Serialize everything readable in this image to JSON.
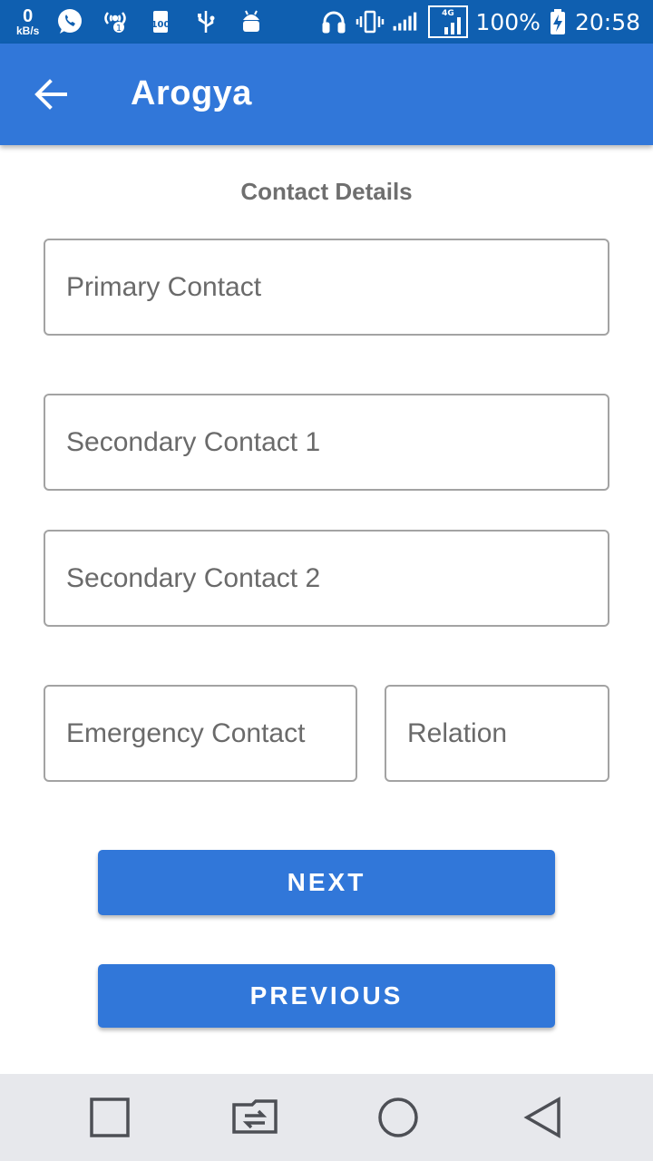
{
  "status_bar": {
    "speed_value": "0",
    "speed_unit": "kB/s",
    "battery_percent": "100%",
    "time": "20:58",
    "network_type": "4G",
    "icons": [
      "whatsapp-icon",
      "hotspot-icon",
      "storage-icon",
      "usb-icon",
      "android-debug-icon",
      "headset-icon",
      "vibrate-icon",
      "signal-icon",
      "signal-4g-icon",
      "battery-charging-icon"
    ]
  },
  "app_bar": {
    "title": "Arogya",
    "back_icon": "arrow-left-icon"
  },
  "form": {
    "section_title": "Contact Details",
    "primary_contact": {
      "placeholder": "Primary Contact",
      "value": ""
    },
    "secondary_contact_1": {
      "placeholder": "Secondary Contact 1",
      "value": ""
    },
    "secondary_contact_2": {
      "placeholder": "Secondary Contact 2",
      "value": ""
    },
    "emergency_contact": {
      "placeholder": "Emergency Contact",
      "value": ""
    },
    "relation": {
      "placeholder": "Relation",
      "value": ""
    }
  },
  "buttons": {
    "next_label": "NEXT",
    "previous_label": "PREVIOUS"
  },
  "nav_bar": {
    "icons": [
      "recents-square-icon",
      "switch-app-icon",
      "home-circle-icon",
      "back-triangle-icon"
    ]
  },
  "colors": {
    "status_bar": "#0f5fb0",
    "primary": "#3177d9",
    "field_border": "#a3a3a3",
    "section_title": "#6f6f6f",
    "nav_bar": "#e7e8ec"
  }
}
